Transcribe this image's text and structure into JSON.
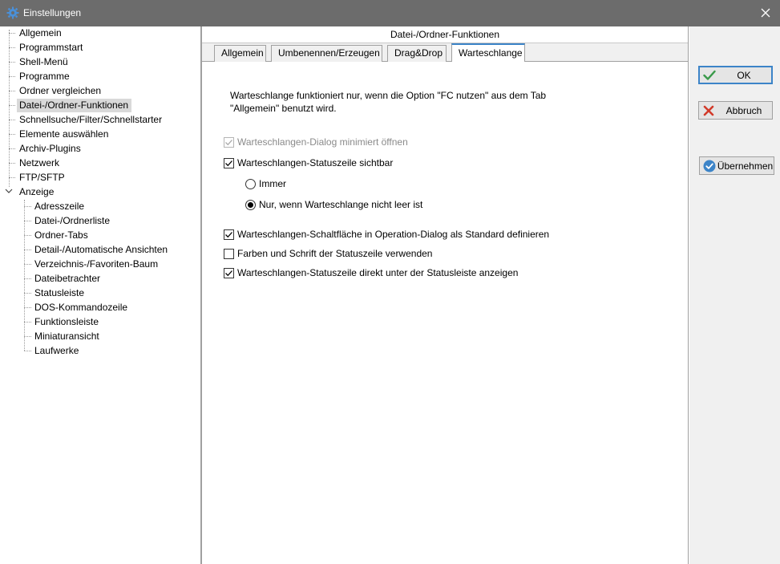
{
  "window": {
    "title": "Einstellungen",
    "close_glyph": "✕",
    "icon": "gear-icon"
  },
  "tree": {
    "items": [
      {
        "label": "Allgemein"
      },
      {
        "label": "Programmstart"
      },
      {
        "label": "Shell-Menü"
      },
      {
        "label": "Programme"
      },
      {
        "label": "Ordner vergleichen"
      },
      {
        "label": "Datei-/Ordner-Funktionen",
        "selected": true
      },
      {
        "label": "Schnellsuche/Filter/Schnellstarter"
      },
      {
        "label": "Elemente auswählen"
      },
      {
        "label": "Archiv-Plugins"
      },
      {
        "label": "Netzwerk"
      },
      {
        "label": "FTP/SFTP"
      },
      {
        "label": "Anzeige",
        "expanded": true
      }
    ],
    "children": [
      {
        "label": "Adresszeile"
      },
      {
        "label": "Datei-/Ordnerliste"
      },
      {
        "label": "Ordner-Tabs"
      },
      {
        "label": "Detail-/Automatische Ansichten"
      },
      {
        "label": "Verzeichnis-/Favoriten-Baum"
      },
      {
        "label": "Dateibetrachter"
      },
      {
        "label": "Statusleiste"
      },
      {
        "label": "DOS-Kommandozeile"
      },
      {
        "label": "Funktionsleiste"
      },
      {
        "label": "Miniaturansicht"
      },
      {
        "label": "Laufwerke"
      }
    ]
  },
  "panel": {
    "header": "Datei-/Ordner-Funktionen",
    "tabs": [
      {
        "label": "Allgemein"
      },
      {
        "label": "Umbenennen/Erzeugen"
      },
      {
        "label": "Drag&Drop"
      },
      {
        "label": "Warteschlange",
        "active": true
      }
    ],
    "description_line1": "Warteschlange funktioniert nur, wenn die Option \"FC nutzen\" aus dem Tab",
    "description_line2": "\"Allgemein\" benutzt wird.",
    "options": {
      "minimized": {
        "label": "Warteschlangen-Dialog minimiert öffnen",
        "checked": true,
        "disabled": true
      },
      "statusbar_visible": {
        "label": "Warteschlangen-Statuszeile sichtbar",
        "checked": true
      },
      "radio_always": {
        "label": "Immer",
        "selected": false
      },
      "radio_not_empty": {
        "label": "Nur, wenn Warteschlange nicht leer ist",
        "selected": true
      },
      "default_button": {
        "label": "Warteschlangen-Schaltfläche in Operation-Dialog als Standard definieren",
        "checked": true
      },
      "colors_font": {
        "label": "Farben und Schrift der Statuszeile verwenden",
        "checked": false
      },
      "below_statusbar": {
        "label": "Warteschlangen-Statuszeile direkt unter der Statusleiste anzeigen",
        "checked": true
      }
    }
  },
  "buttons": {
    "ok": "OK",
    "cancel": "Abbruch",
    "apply": "Übernehmen"
  },
  "colors": {
    "accent": "#3c84c8",
    "ok_check": "#3a9a4a",
    "cancel_x": "#d23a2a",
    "titlebar": "#6c6c6c"
  }
}
